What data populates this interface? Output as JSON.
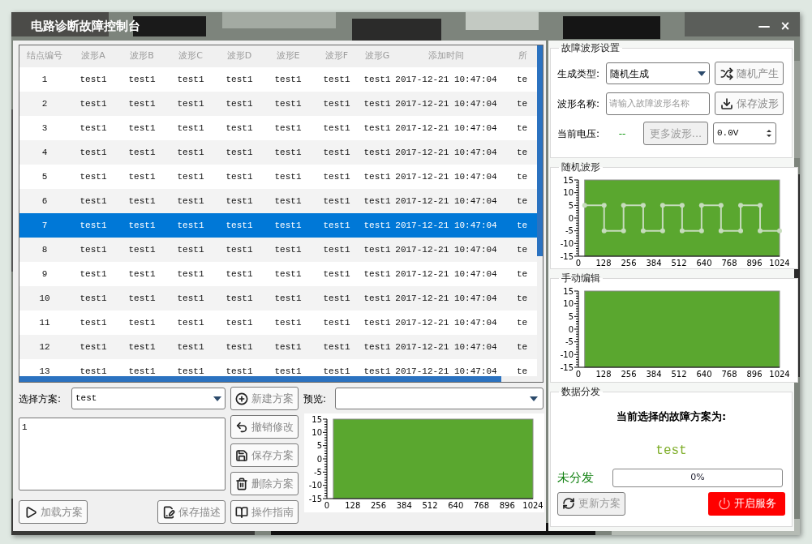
{
  "window": {
    "title": "电路诊断故障控制台",
    "controls": [
      "—",
      "×"
    ]
  },
  "table": {
    "columns": [
      "结点编号",
      "波形A",
      "波形B",
      "波形C",
      "波形D",
      "波形E",
      "波形F",
      "波形G",
      "添加时间",
      "所"
    ],
    "rows": [
      {
        "selected": false,
        "cells": [
          "1",
          "test1",
          "test1",
          "test1",
          "test1",
          "test1",
          "test1",
          "test1",
          "2017-12-21 10:47:04",
          "te"
        ]
      },
      {
        "selected": false,
        "cells": [
          "2",
          "test1",
          "test1",
          "test1",
          "test1",
          "test1",
          "test1",
          "test1",
          "2017-12-21 10:47:04",
          "te"
        ]
      },
      {
        "selected": false,
        "cells": [
          "3",
          "test1",
          "test1",
          "test1",
          "test1",
          "test1",
          "test1",
          "test1",
          "2017-12-21 10:47:04",
          "te"
        ]
      },
      {
        "selected": false,
        "cells": [
          "4",
          "test1",
          "test1",
          "test1",
          "test1",
          "test1",
          "test1",
          "test1",
          "2017-12-21 10:47:04",
          "te"
        ]
      },
      {
        "selected": false,
        "cells": [
          "5",
          "test1",
          "test1",
          "test1",
          "test1",
          "test1",
          "test1",
          "test1",
          "2017-12-21 10:47:04",
          "te"
        ]
      },
      {
        "selected": false,
        "cells": [
          "6",
          "test1",
          "test1",
          "test1",
          "test1",
          "test1",
          "test1",
          "test1",
          "2017-12-21 10:47:04",
          "te"
        ]
      },
      {
        "selected": true,
        "cells": [
          "7",
          "test1",
          "test1",
          "test1",
          "test1",
          "test1",
          "test1",
          "test1",
          "2017-12-21 10:47:04",
          "te"
        ]
      },
      {
        "selected": false,
        "cells": [
          "8",
          "test1",
          "test1",
          "test1",
          "test1",
          "test1",
          "test1",
          "test1",
          "2017-12-21 10:47:04",
          "te"
        ]
      },
      {
        "selected": false,
        "cells": [
          "9",
          "test1",
          "test1",
          "test1",
          "test1",
          "test1",
          "test1",
          "test1",
          "2017-12-21 10:47:04",
          "te"
        ]
      },
      {
        "selected": false,
        "cells": [
          "10",
          "test1",
          "test1",
          "test1",
          "test1",
          "test1",
          "test1",
          "test1",
          "2017-12-21 10:47:04",
          "te"
        ]
      },
      {
        "selected": false,
        "cells": [
          "11",
          "test1",
          "test1",
          "test1",
          "test1",
          "test1",
          "test1",
          "test1",
          "2017-12-21 10:47:04",
          "te"
        ]
      },
      {
        "selected": false,
        "cells": [
          "12",
          "test1",
          "test1",
          "test1",
          "test1",
          "test1",
          "test1",
          "test1",
          "2017-12-21 10:47:04",
          "te"
        ]
      },
      {
        "selected": false,
        "cells": [
          "13",
          "test1",
          "test1",
          "test1",
          "test1",
          "test1",
          "test1",
          "test1",
          "2017-12-21 10:47:04",
          "te"
        ]
      }
    ]
  },
  "scheme": {
    "label": "选择方案:",
    "select": "test",
    "new_button": "新建方案",
    "description": "1",
    "undo_button": "撤销修改",
    "save_button": "保存方案",
    "delete_button": "删除方案",
    "load_button": "加载方案",
    "save_description_button": "保存描述",
    "guide_button": "操作指南"
  },
  "preview": {
    "label": "预览:",
    "chart_data": {
      "type": "line",
      "xlim": [
        0,
        1024
      ],
      "ylim": [
        -15,
        15
      ],
      "xticks": [
        0,
        128,
        256,
        384,
        512,
        640,
        768,
        896,
        1024
      ],
      "yticks": [
        -15,
        -10,
        -5,
        0,
        5,
        10,
        15
      ]
    }
  },
  "waveform_settings": {
    "title": "故障波形设置",
    "type_label": "生成类型:",
    "type_value": "随机生成",
    "random_button": "随机产生",
    "name_label": "波形名称:",
    "name_placeholder": "请输入故障波形名称",
    "save_button": "保存波形",
    "voltage_label": "当前电压:",
    "voltage_value": "--",
    "more_button": "更多波形...",
    "voltage_input": "0.0V"
  },
  "random_wave": {
    "title": "随机波形",
    "chart_data": {
      "type": "line",
      "xlim": [
        0,
        1024
      ],
      "ylim": [
        -15,
        15
      ],
      "xticks": [
        0,
        128,
        256,
        384,
        512,
        640,
        768,
        896,
        1024
      ],
      "yticks": [
        -15,
        -10,
        -5,
        0,
        5,
        10,
        15
      ],
      "x": [
        32,
        131,
        131,
        230,
        230,
        330,
        330,
        429,
        429,
        528,
        528,
        627,
        627,
        726,
        726,
        826,
        826,
        925,
        925,
        1024
      ],
      "series": [
        {
          "color": "#c6dcbc",
          "marker": "circle",
          "values": [
            5,
            5,
            -5,
            -5,
            5,
            5,
            -5,
            -5,
            5,
            5,
            -5,
            -5,
            5,
            5,
            -5,
            -5,
            5,
            5,
            -5,
            -5
          ]
        }
      ]
    }
  },
  "manual_edit": {
    "title": "手动编辑",
    "chart_data": {
      "type": "line",
      "xlim": [
        0,
        1024
      ],
      "ylim": [
        -15,
        15
      ],
      "xticks": [
        0,
        128,
        256,
        384,
        512,
        640,
        768,
        896,
        1024
      ],
      "yticks": [
        -15,
        -10,
        -5,
        0,
        5,
        10,
        15
      ]
    }
  },
  "distribution": {
    "title": "数据分发",
    "heading": "当前选择的故障方案为:",
    "scheme": "test",
    "status": "未分发",
    "progress": {
      "level": 0,
      "text": "0%"
    },
    "update_button": "更新方案",
    "start_button": "开启服务"
  }
}
